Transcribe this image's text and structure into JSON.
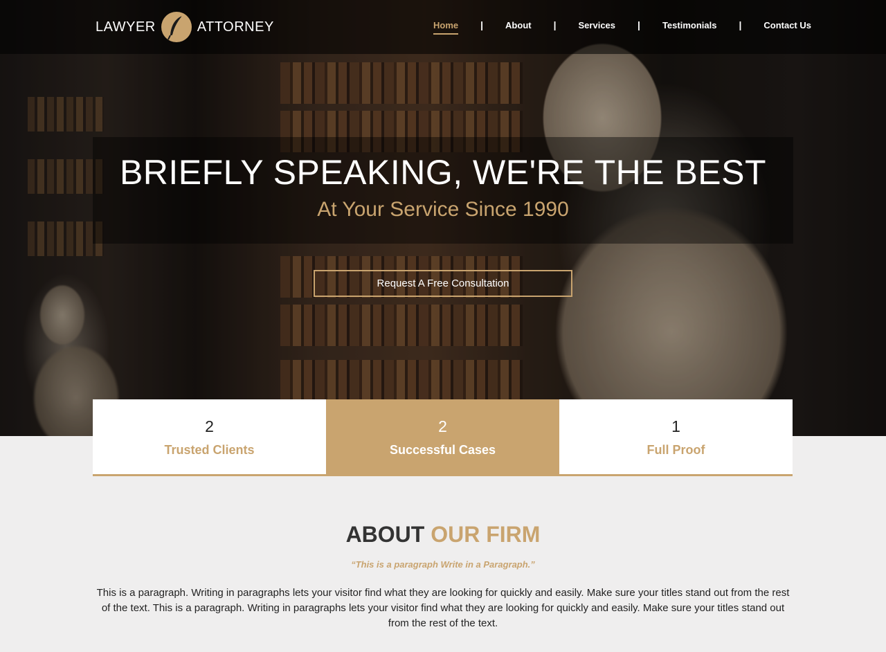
{
  "brand": {
    "left_word": "LAWYER",
    "right_word": "ATTORNEY",
    "emblem_icon": "quill-icon",
    "accent_color": "#c9a46f"
  },
  "nav": {
    "items": [
      {
        "label": "Home",
        "active": true
      },
      {
        "label": "About"
      },
      {
        "label": "Services"
      },
      {
        "label": "Testimonials"
      },
      {
        "label": "Contact Us"
      }
    ],
    "separator": "|"
  },
  "hero": {
    "title": "BRIEFLY SPEAKING, WE'RE THE BEST",
    "subtitle": "At Your Service Since 1990",
    "cta_label": "Request A Free Consultation"
  },
  "stats": [
    {
      "value": "2",
      "label": "Trusted Clients"
    },
    {
      "value": "2",
      "label": "Successful Cases"
    },
    {
      "value": "1",
      "label": "Full Proof"
    }
  ],
  "about": {
    "title_plain": "ABOUT",
    "title_accent": "OUR FIRM",
    "quote": "“This is a paragraph Write in a Paragraph.”",
    "body": "This is a paragraph. Writing in paragraphs lets your visitor find what they are looking for quickly and easily. Make sure your titles stand out from the rest of the text. This is a paragraph. Writing in paragraphs lets your visitor find what they are looking for quickly and easily. Make sure your titles stand out from the rest of the text."
  }
}
